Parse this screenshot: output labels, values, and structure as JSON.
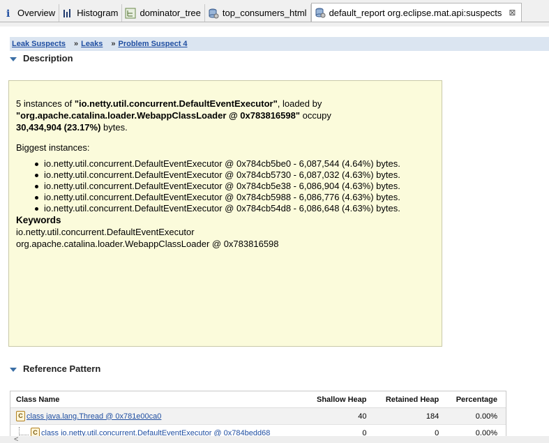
{
  "tabs": [
    {
      "label": "Overview",
      "icon": "info-icon"
    },
    {
      "label": "Histogram",
      "icon": "histogram-icon"
    },
    {
      "label": "dominator_tree",
      "icon": "tree-icon"
    },
    {
      "label": "top_consumers_html",
      "icon": "database-icon"
    },
    {
      "label": "default_report  org.eclipse.mat.api:suspects",
      "icon": "report-gear-icon",
      "active": true
    }
  ],
  "tab_close": "⊠",
  "breadcrumb": {
    "items": [
      "Leak Suspects",
      "Leaks",
      "Problem Suspect 4"
    ],
    "separator": "»"
  },
  "description": {
    "header": "Description",
    "line1_pre": "5 instances of ",
    "class_name": "\"io.netty.util.concurrent.DefaultEventExecutor\"",
    "line1_post": ", loaded by",
    "loader": "\"org.apache.catalina.loader.WebappClassLoader @ 0x783816598\"",
    "occupy": " occupy",
    "size": "30,434,904 (23.17%)",
    "size_post": " bytes.",
    "biggest_label": "Biggest instances:",
    "instances": [
      "io.netty.util.concurrent.DefaultEventExecutor @ 0x784cb5be0 - 6,087,544 (4.64%) bytes.",
      "io.netty.util.concurrent.DefaultEventExecutor @ 0x784cb5730 - 6,087,032 (4.63%) bytes.",
      "io.netty.util.concurrent.DefaultEventExecutor @ 0x784cb5e38 - 6,086,904 (4.63%) bytes.",
      "io.netty.util.concurrent.DefaultEventExecutor @ 0x784cb5988 - 6,086,776 (4.63%) bytes.",
      "io.netty.util.concurrent.DefaultEventExecutor @ 0x784cb54d8 - 6,086,648 (4.63%) bytes."
    ],
    "keywords_label": "Keywords",
    "keywords": [
      "io.netty.util.concurrent.DefaultEventExecutor",
      "org.apache.catalina.loader.WebappClassLoader @ 0x783816598"
    ]
  },
  "reference_pattern": {
    "header": "Reference Pattern",
    "columns": [
      "Class Name",
      "Shallow Heap",
      "Retained Heap",
      "Percentage"
    ],
    "rows": [
      {
        "name": "class java.lang.Thread @ 0x781e00ca0",
        "shallow": "40",
        "retained": "184",
        "percentage": "0.00%"
      },
      {
        "name": "class io.netty.util.concurrent.DefaultEventExecutor @ 0x784bedd68",
        "shallow": "0",
        "retained": "0",
        "percentage": "0.00%"
      }
    ]
  },
  "scroll_arrow": "<"
}
